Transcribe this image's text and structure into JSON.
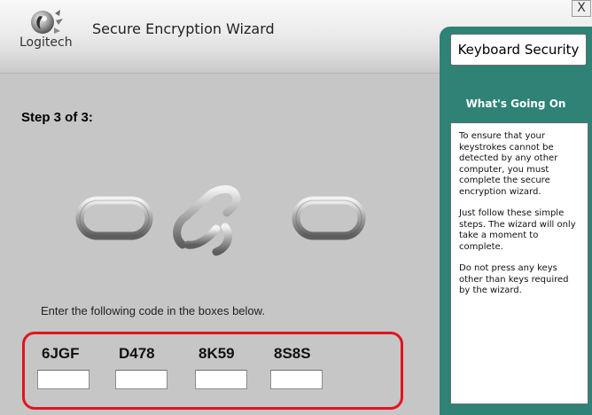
{
  "header": {
    "logo_text": "Logitech",
    "title": "Secure Encryption Wizard",
    "close_label": "X"
  },
  "main": {
    "step_label": "Step 3 of 3:",
    "instruction": "Enter the following code in the boxes below.",
    "codes": [
      {
        "code": "6JGF",
        "input_value": ""
      },
      {
        "code": "D478",
        "input_value": ""
      },
      {
        "code": "8K59",
        "input_value": ""
      },
      {
        "code": "8S8S",
        "input_value": ""
      }
    ]
  },
  "sidebar": {
    "title": "Keyboard Security",
    "heading": "What's Going On",
    "paragraphs": [
      "To ensure that your keystrokes cannot be detected by any other computer, you must complete the secure encryption wizard.",
      "Just follow these simple steps. The wizard will only take a moment to complete.",
      "Do not press any keys other than keys required by the wizard."
    ]
  },
  "colors": {
    "background": "#c6c6c6",
    "sidebar": "#2e8276",
    "highlight_border": "#e4141e"
  }
}
